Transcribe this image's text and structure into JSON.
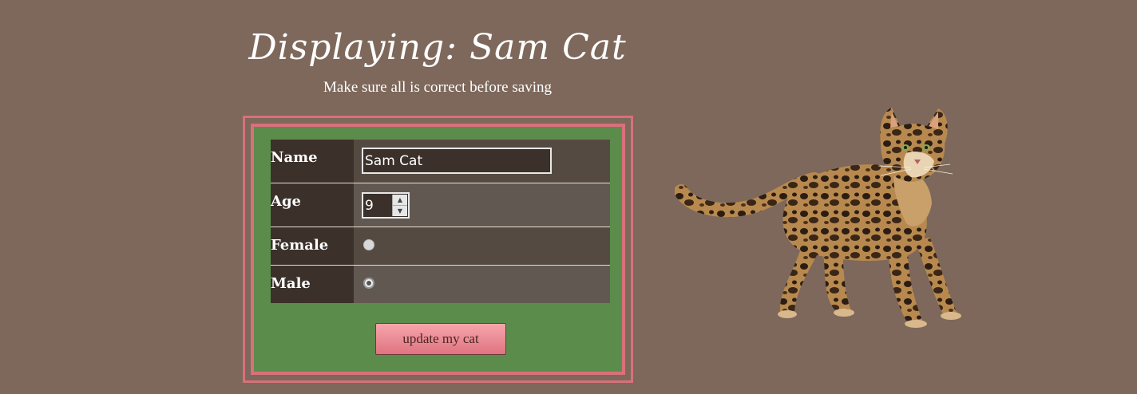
{
  "header": {
    "title": "Displaying: Sam Cat",
    "subtitle": "Make sure all is correct before saving"
  },
  "form": {
    "name_label": "Name",
    "name_value": "Sam Cat",
    "age_label": "Age",
    "age_value": "9",
    "female_label": "Female",
    "female_checked": false,
    "male_label": "Male",
    "male_checked": true,
    "submit_label": "update my cat"
  },
  "colors": {
    "background": "#7d685b",
    "frame_border": "#d9707a",
    "form_background": "#5c8c4b",
    "label_cell": "#3b302a",
    "button_gradient_top": "#f6a5ac",
    "button_gradient_bottom": "#df7480"
  },
  "image": {
    "subject": "cat-photo"
  }
}
